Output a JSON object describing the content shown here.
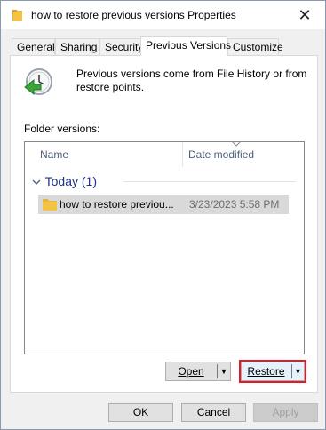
{
  "window": {
    "title": "how to restore previous versions Properties",
    "close_glyph": "✕"
  },
  "tabs": [
    {
      "label": "General"
    },
    {
      "label": "Sharing"
    },
    {
      "label": "Security"
    },
    {
      "label": "Previous Versions",
      "active": true
    },
    {
      "label": "Customize"
    }
  ],
  "panel": {
    "info_text": "Previous versions come from File History or from restore points.",
    "folder_versions_label": "Folder versions:",
    "columns": {
      "name": "Name",
      "date_modified": "Date modified"
    },
    "group": {
      "label": "Today (1)"
    },
    "rows": [
      {
        "name": "how to restore previou...",
        "date_modified": "3/23/2023 5:58 PM"
      }
    ],
    "buttons": {
      "open": "Open",
      "restore": "Restore",
      "dropdown_glyph": "▼"
    }
  },
  "footer": {
    "ok": "OK",
    "cancel": "Cancel",
    "apply": "Apply"
  },
  "colors": {
    "highlight_outline": "#e01b24",
    "group_text": "#1e3287",
    "folder": "#f4c342"
  },
  "icons": {
    "title": "folder-icon",
    "close": "close-icon",
    "info": "clock-restore-icon",
    "row": "folder-icon",
    "sort": "sort-indicator-icon",
    "group": "chevron-down-icon"
  }
}
